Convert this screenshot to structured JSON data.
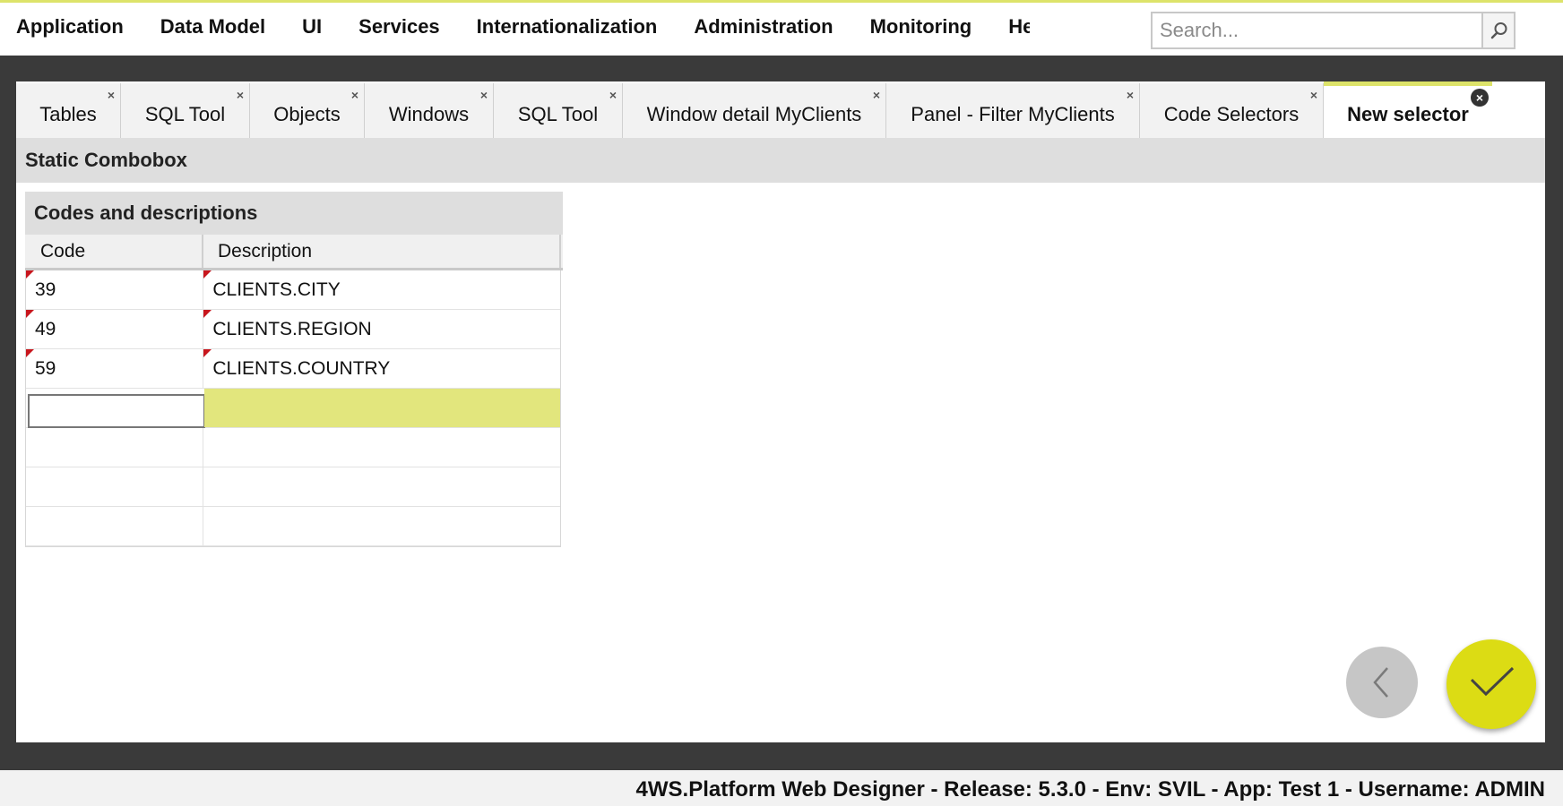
{
  "menubar": {
    "items": [
      "Application",
      "Data Model",
      "UI",
      "Services",
      "Internationalization",
      "Administration",
      "Monitoring",
      "He"
    ],
    "search_placeholder": "Search...",
    "search_icon": "magnifier-icon"
  },
  "tabs": [
    {
      "label": "Tables",
      "close": "×"
    },
    {
      "label": "SQL Tool",
      "close": "×"
    },
    {
      "label": "Objects",
      "close": "×"
    },
    {
      "label": "Windows",
      "close": "×"
    },
    {
      "label": "SQL Tool",
      "close": "×"
    },
    {
      "label": "Window detail MyClients",
      "close": "×"
    },
    {
      "label": "Panel - Filter MyClients",
      "close": "×"
    },
    {
      "label": "Code Selectors",
      "close": "×"
    },
    {
      "label": "New selector",
      "close": "×",
      "active": true
    }
  ],
  "section": {
    "title": "Static Combobox"
  },
  "grid": {
    "title": "Codes and descriptions",
    "columns": {
      "code": "Code",
      "description": "Description"
    },
    "rows": [
      {
        "code": "39",
        "description": "CLIENTS.CITY"
      },
      {
        "code": "49",
        "description": "CLIENTS.REGION"
      },
      {
        "code": "59",
        "description": "CLIENTS.COUNTRY"
      }
    ],
    "new_row": {
      "code": "",
      "description": ""
    }
  },
  "actions": {
    "back_icon": "chevron-left-icon",
    "confirm_icon": "checkmark-icon"
  },
  "colors": {
    "accent": "#dde36a",
    "confirm_button": "#dcdc14",
    "editing_row": "#e2e67d",
    "dirty_marker": "#c8161d",
    "frame": "#3a3a3a"
  },
  "status": {
    "text": "4WS.Platform Web Designer - Release: 5.3.0 - Env: SVIL - App: Test 1 - Username: ADMIN"
  }
}
